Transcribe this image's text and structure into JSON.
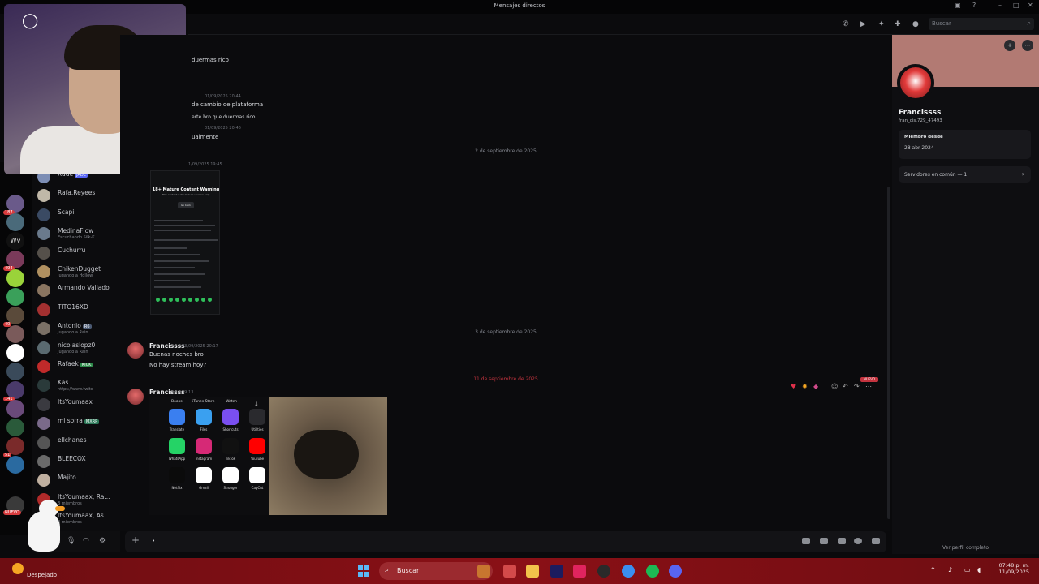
{
  "window": {
    "title": "Mensajes directos"
  },
  "topbar": {
    "search_placeholder": "Buscar"
  },
  "dm_list": [
    {
      "name": "Xade",
      "tag": "JADE",
      "tag_color": "#5865f2",
      "color": "#7d8eb5"
    },
    {
      "name": "Rafa.Reyees",
      "color": "#c0b8a8"
    },
    {
      "name": "Scapi",
      "color": "#3a4a63"
    },
    {
      "name": "MedinaFlow",
      "sub": "Escuchando Silk-K",
      "color": "#6a7a8c"
    },
    {
      "name": "Cuchurru",
      "color": "#55504a"
    },
    {
      "name": "ChikenDugget",
      "sub": "Jugando a Hollow",
      "color": "#b09060"
    },
    {
      "name": "Armando Vallado",
      "color": "#8a7560"
    },
    {
      "name": "TITO16XD",
      "color": "#a33030"
    },
    {
      "name": "Antonio",
      "tag": "R6",
      "tag_color": "#4b5a73",
      "sub": "Jugando a Rain",
      "color": "#7a7066"
    },
    {
      "name": "nicolaslopz0",
      "sub": "Jugando a Rain",
      "color": "#5a6a70"
    },
    {
      "name": "Rafaek",
      "tag": "KICK",
      "tag_color": "#2e8b4a",
      "color": "#c02a2a"
    },
    {
      "name": "Kas",
      "sub": "https://www.twitc",
      "color": "#2a3a3a"
    },
    {
      "name": "ItsYoumaax",
      "color": "#3a3a40"
    },
    {
      "name": "mi sorra",
      "tag": "MXRP",
      "tag_color": "#2e7a5a",
      "color": "#7a6a8a"
    },
    {
      "name": "ellchanes",
      "color": "#555"
    },
    {
      "name": "BLEECOX",
      "color": "#6a6a6a"
    },
    {
      "name": "Majito",
      "color": "#c0b0a0"
    },
    {
      "name": "ItsYoumaax, Ra...",
      "sub": "3 miembros",
      "color": "#b02a2a"
    },
    {
      "name": "ItsYoumaax, As...",
      "sub": "3 miembros",
      "color": "#b02a2a"
    }
  ],
  "server_badges": {
    "s1": "187",
    "s2": "494",
    "s3": "40",
    "s4": "141",
    "s5": "51",
    "new": "NUEVO"
  },
  "server_label": "Wv",
  "messages": {
    "m1": "duermas rico",
    "m2_time": "01/09/2025 20:44",
    "m2": "de cambio de plataforma",
    "m3": "erte bro que duermas rico",
    "m3_time": "01/09/2025 20:46",
    "m4": "ualmente",
    "d1": "2 de septiembre de 2025",
    "shot_time": "1/09/2025 19:45",
    "d2": "3 de septiembre de 2025",
    "f_author": "Francissss",
    "f_time": "03/09/2025 20:17",
    "f_line1": "Buenas noches bro",
    "f_line2": "No hay stream hoy?",
    "d3": "11 de septiembre de 2025",
    "new_pill": "NUEVO",
    "f2_author": "Francissss",
    "f2_time": "19:13"
  },
  "screenshot": {
    "heading": "18+ Mature Content Warning",
    "sub": "This content is for mature viewers only",
    "button": "Go back"
  },
  "phone": {
    "folders": [
      "Books",
      "iTunes Store",
      "Watch"
    ],
    "apps": [
      {
        "label": "Translate",
        "color": "#3a7ff0"
      },
      {
        "label": "Files",
        "color": "#3aa0f0"
      },
      {
        "label": "Shortcuts",
        "color": "#7a4ff0"
      },
      {
        "label": "Utilities",
        "color": "#2a2a2e"
      },
      {
        "label": "WhatsApp",
        "color": "#25d366"
      },
      {
        "label": "Instagram",
        "color": "#d62976"
      },
      {
        "label": "TikTok",
        "color": "#111111"
      },
      {
        "label": "YouTube",
        "color": "#ff0000"
      },
      {
        "label": "Netflix",
        "color": "#0b0b0b"
      },
      {
        "label": "Gmail",
        "color": "#ffffff"
      },
      {
        "label": "Stronger",
        "color": "#ffffff"
      },
      {
        "label": "CapCut",
        "color": "#ffffff"
      }
    ]
  },
  "profile": {
    "name": "Francissss",
    "tag": "fran_cis.729_47493",
    "since_label": "Miembro desde",
    "since_value": "28 abr 2024",
    "mutual": "Servidores en común — 1",
    "view_full": "Ver perfil completo"
  },
  "taskbar": {
    "weather": "Despejado",
    "search": "Buscar",
    "time": "07:48 p. m.",
    "date": "11/09/2025"
  }
}
